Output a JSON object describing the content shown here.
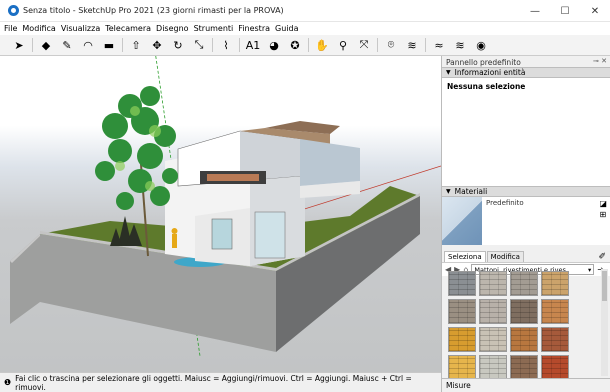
{
  "window": {
    "title": "Senza titolo - SketchUp Pro 2021 (23 giorni rimasti per la PROVA)"
  },
  "menu": [
    "File",
    "Modifica",
    "Visualizza",
    "Telecamera",
    "Disegno",
    "Strumenti",
    "Finestra",
    "Guida"
  ],
  "toolbar": [
    {
      "name": "select-icon",
      "glyph": "➤"
    },
    {
      "name": "eraser-icon",
      "glyph": "◆"
    },
    {
      "name": "pencil-icon",
      "glyph": "✎"
    },
    {
      "name": "arc-icon",
      "glyph": "◠"
    },
    {
      "name": "rectangle-icon",
      "glyph": "▬"
    },
    {
      "name": "push-pull-icon",
      "glyph": "⇧"
    },
    {
      "name": "move-icon",
      "glyph": "✥"
    },
    {
      "name": "rotate-icon",
      "glyph": "↻"
    },
    {
      "name": "scale-icon",
      "glyph": "⤡"
    },
    {
      "name": "tape-measure-icon",
      "glyph": "⌇"
    },
    {
      "name": "text-icon",
      "glyph": "A1"
    },
    {
      "name": "paint-bucket-icon",
      "glyph": "◕"
    },
    {
      "name": "orbit-icon",
      "glyph": "✪"
    },
    {
      "name": "pan-icon",
      "glyph": "✋"
    },
    {
      "name": "zoom-icon",
      "glyph": "⚲"
    },
    {
      "name": "zoom-extents-icon",
      "glyph": "⤧"
    },
    {
      "name": "warehouse-icon",
      "glyph": "⌾"
    },
    {
      "name": "extension-warehouse-icon",
      "glyph": "≋"
    },
    {
      "name": "layout-icon",
      "glyph": "≈"
    },
    {
      "name": "extension-manager-icon",
      "glyph": "≋"
    },
    {
      "name": "account-icon",
      "glyph": "◉"
    }
  ],
  "panel": {
    "title": "Pannello predefinito",
    "entity_info": {
      "header": "Informazioni entità",
      "selection": "Nessuna selezione"
    },
    "materials": {
      "header": "Materiali",
      "current": "Predefinito",
      "tabs": [
        "Seleziona",
        "Modifica"
      ],
      "library": "Mattoni, rivestimenti e rives"
    },
    "measurements_label": "Misure"
  },
  "swatches": [
    "#8b8f93",
    "#bcb6ad",
    "#a39c93",
    "#cba36b",
    "#9a8f82",
    "#b8b1a9",
    "#7f6e60",
    "#c7864e",
    "#d79c2f",
    "#c9c2b5",
    "#b8773f",
    "#a65a3b",
    "#e6b54c",
    "#c8c8c0",
    "#8c6b53",
    "#b54a2c"
  ],
  "status": {
    "text": "Fai clic o trascina per selezionare gli oggetti. Maiusc = Aggiungi/rimuovi. Ctrl = Aggiungi. Maiusc + Ctrl = rimuovi."
  },
  "colors": {
    "accent": "#1a6fc4",
    "grass": "#5e7a2c",
    "wall": "#9e9f9e"
  }
}
